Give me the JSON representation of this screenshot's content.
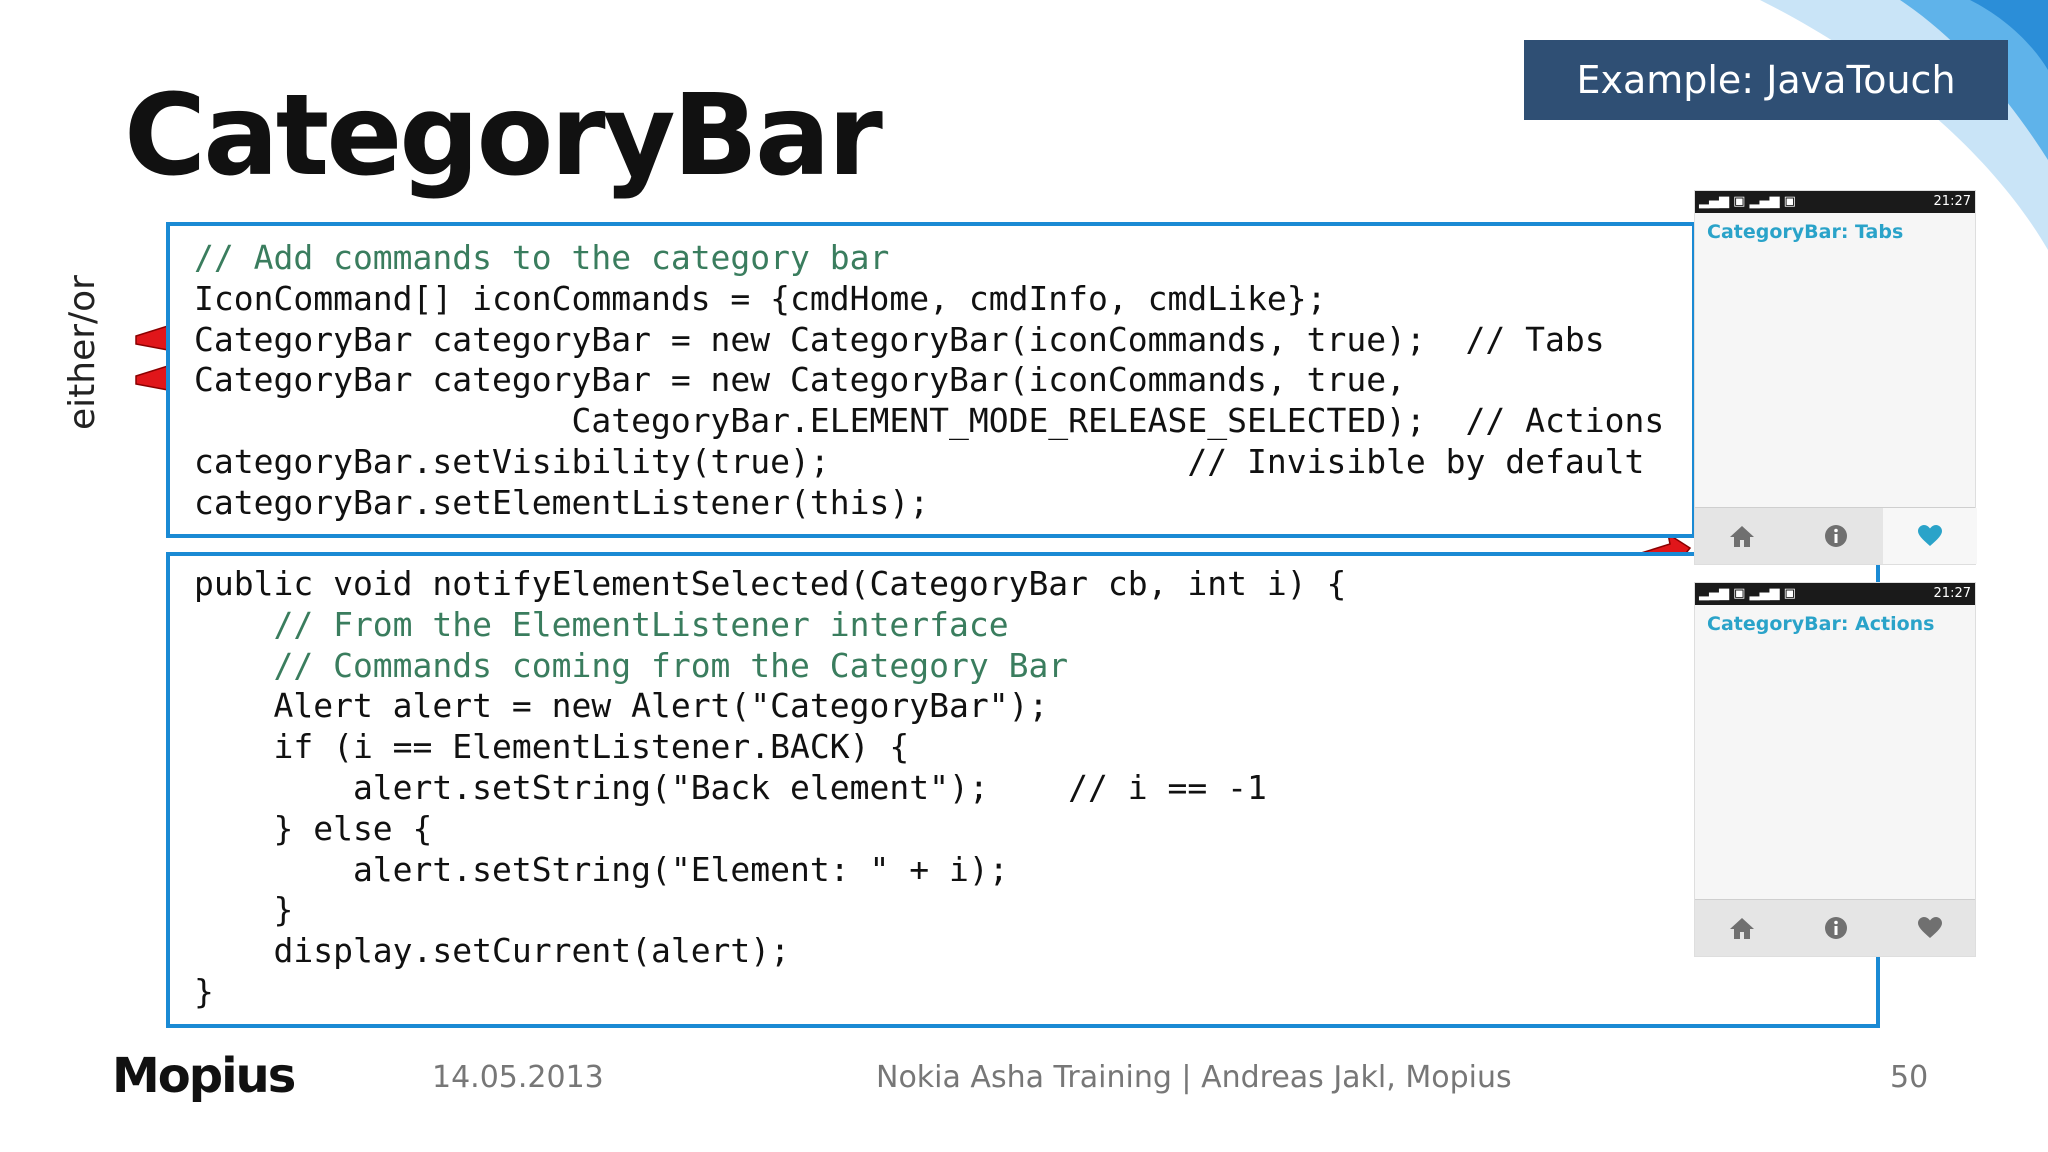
{
  "slide": {
    "title": "CategoryBar",
    "example_tag": "Example: JavaTouch",
    "side_label": "either/or"
  },
  "code_top": [
    "// Add commands to the category bar",
    "IconCommand[] iconCommands = {cmdHome, cmdInfo, cmdLike};",
    "CategoryBar categoryBar = new CategoryBar(iconCommands, true);  // Tabs",
    "CategoryBar categoryBar = new CategoryBar(iconCommands, true,",
    "                   CategoryBar.ELEMENT_MODE_RELEASE_SELECTED);  // Actions",
    "categoryBar.setVisibility(true);                  // Invisible by default",
    "categoryBar.setElementListener(this);"
  ],
  "code_bottom": [
    "public void notifyElementSelected(CategoryBar cb, int i) {",
    "    // From the ElementListener interface",
    "    // Commands coming from the Category Bar",
    "    Alert alert = new Alert(\"CategoryBar\");",
    "    if (i == ElementListener.BACK) {",
    "        alert.setString(\"Back element\");    // i == -1",
    "    } else {",
    "        alert.setString(\"Element: \" + i);",
    "    }",
    "    display.setCurrent(alert);",
    "}"
  ],
  "phones": [
    {
      "title": "CategoryBar: Tabs",
      "status_time": "21:27",
      "status_icons": "signal, sim-1, signal, sim-2",
      "bar_items": [
        "home-icon",
        "info-icon",
        "heart-icon"
      ],
      "selected_item": "heart-icon"
    },
    {
      "title": "CategoryBar: Actions",
      "status_time": "21:27",
      "status_icons": "signal, sim-1, signal, sim-2",
      "bar_items": [
        "home-icon",
        "info-icon",
        "heart-icon"
      ],
      "selected_item": ""
    }
  ],
  "footer": {
    "logo": "Mopius",
    "date": "14.05.2013",
    "center": "Nokia Asha Training | Andreas Jakl, Mopius",
    "page_number": "50"
  },
  "colors": {
    "accent_blue": "#1a8ad4",
    "tag_bg": "#2f4f74",
    "arrow_red": "#e0161a",
    "phone_title": "#2aa3c9",
    "code_comment": "#3a7d5e",
    "code_keyword": "#7a1a4e",
    "code_identifier": "#1b3fbf"
  }
}
